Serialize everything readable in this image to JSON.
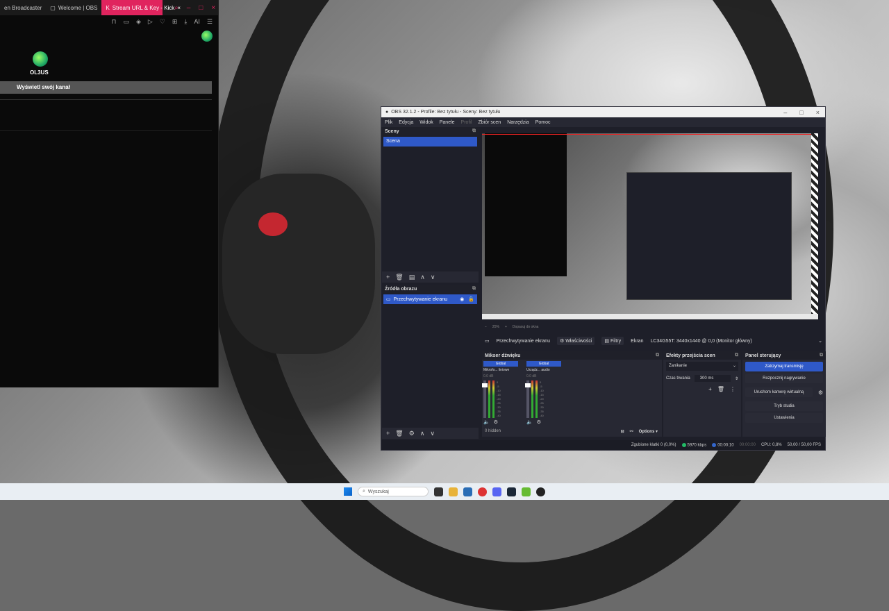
{
  "browser": {
    "tabs": [
      {
        "label": "en Broadcaster"
      },
      {
        "label": "Welcome | OBS"
      },
      {
        "label": "Stream URL & Key - Kick"
      }
    ],
    "toolbar_icons": [
      "bookmark-icon",
      "reading-list-icon",
      "shield-icon",
      "play-icon",
      "heart-icon",
      "wallet-icon",
      "download-icon",
      "ai-icon",
      "menu-icon"
    ],
    "ai_label": "AI",
    "channel_name": "OL3US",
    "view_channel_label": "Wyświetl swój kanał"
  },
  "obs": {
    "title": "OBS 32.1.2 - Profile: Bez tytułu - Sceny: Bez tytułu",
    "menu": [
      "Plik",
      "Edycja",
      "Widok",
      "Panele",
      "Profil",
      "Zbiór scen",
      "Narzędzia",
      "Pomoc"
    ],
    "scenes": {
      "header": "Sceny",
      "items": [
        "Scena"
      ]
    },
    "sources": {
      "header": "Źródła obrazu",
      "items": [
        "Przechwytywanie ekranu"
      ]
    },
    "zoom_text": "25%",
    "zoom_fit_text": "Dopasuj do okna",
    "source_bar": {
      "source_name": "Przechwytywanie ekranu",
      "properties_label": "Właściwości",
      "filters_label": "Filtry",
      "screen_label": "Ekran",
      "screen_value": "LC34G55T: 3440x1440 @ 0,0 (Monitor główny)"
    },
    "mixer": {
      "header": "Mikser dźwięku",
      "tracks": [
        {
          "global": "Global",
          "name": "Mikrofo... liniowe",
          "db": "0.0 dB"
        },
        {
          "global": "Global",
          "name": "Urządz... audio",
          "db": "0.0 dB"
        }
      ],
      "scale": [
        "0",
        "-5",
        "-10",
        "-15",
        "-20",
        "-25",
        "-30",
        "-35",
        "-40",
        "-45",
        "-50",
        "-55",
        "-60"
      ],
      "hidden_label": "0 hidden",
      "options_label": "Options"
    },
    "transitions": {
      "header": "Efekty przejścia scen",
      "selected": "Zanikanie",
      "duration_label": "Czas trwania",
      "duration_value": "300 ms"
    },
    "controls": {
      "header": "Panel sterujący",
      "stop_stream": "Zatrzymaj transmisję",
      "start_recording": "Rozpocznij nagrywanie",
      "start_virtual_cam": "Uruchom kamerę wirtualną",
      "studio_mode": "Tryb studia",
      "settings": "Ustawienia"
    },
    "status": {
      "dropped_frames": "Zgubione klatki 0 (0,0%)",
      "bitrate": "5970 kbps",
      "stream_time": "00:00:10",
      "rec_time": "00:00:00",
      "cpu": "CPU: 0,8%",
      "fps": "50,00 / 50,00 FPS"
    }
  },
  "taskbar": {
    "search_placeholder": "Wyszukaj",
    "apps": [
      "file-explorer-icon",
      "folder-icon",
      "store-icon",
      "opera-icon",
      "discord-icon",
      "steam-icon",
      "game-icon",
      "obs-icon"
    ]
  },
  "colors": {
    "kick_accent": "#e0245e",
    "obs_blue": "#2f59c8",
    "obs_bg": "#1e1f29"
  }
}
